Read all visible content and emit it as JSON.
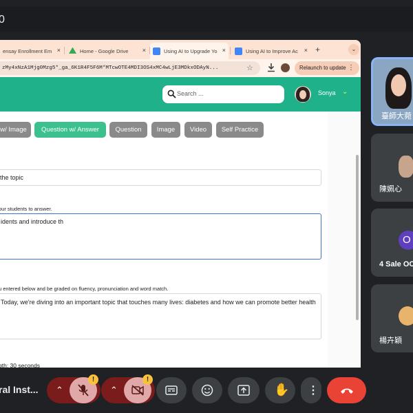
{
  "meet": {
    "window_title": "0",
    "meeting_name": "ral Inst...",
    "participants": [
      {
        "name": "臺師大菀",
        "initial": ""
      },
      {
        "name": "陳姵心",
        "initial": ""
      },
      {
        "name": "4 Sale OC",
        "initial": "O"
      },
      {
        "name": "楊卉穎",
        "initial": ""
      }
    ],
    "controls": {
      "mic_badge": "!",
      "camera_badge": "!"
    }
  },
  "browser": {
    "tabs": [
      {
        "label": "ensay Enrollment Em",
        "icon_color": "#e8703a"
      },
      {
        "label": "Home - Google Drive",
        "icon_color": "#34a853"
      },
      {
        "label": "Using AI to Upgrade Yo",
        "icon_color": "#4285f4"
      },
      {
        "label": "Using AI to Improve Ac",
        "icon_color": "#4285f4"
      }
    ],
    "tab_close": "×",
    "new_tab": "+",
    "tab_menu": "⌄",
    "url": "zMy4xNzA1Mjg0Mzg5*_ga_6K1R4F5F6M*MTcwOTE4MDI3OS4xMC4wLjE3MDkxODAyN...",
    "relaunch_label": "Relaunch to update",
    "relaunch_menu": "⋮"
  },
  "app": {
    "search_placeholder": "Search ...",
    "user_name": "Sonya",
    "accent_color": "#1fb28a",
    "question_types": [
      {
        "label": "w/ Image",
        "active": false
      },
      {
        "label": "Question w/ Answer",
        "active": true
      },
      {
        "label": "Question",
        "active": false
      },
      {
        "label": "Image",
        "active": false
      },
      {
        "label": "Video",
        "active": false
      },
      {
        "label": "Self Practice",
        "active": false
      }
    ],
    "topic_value": "the topic",
    "question_hint": "our students to answer.",
    "question_value": "idents and introduce th",
    "answer_hint": "u entered below and be graded on fluency, pronunciation and word match.",
    "answer_value": "Today, we're diving into an important topic that touches many lives: diabetes and how we can promote better health",
    "length_label": "gth: 30 seconds"
  }
}
